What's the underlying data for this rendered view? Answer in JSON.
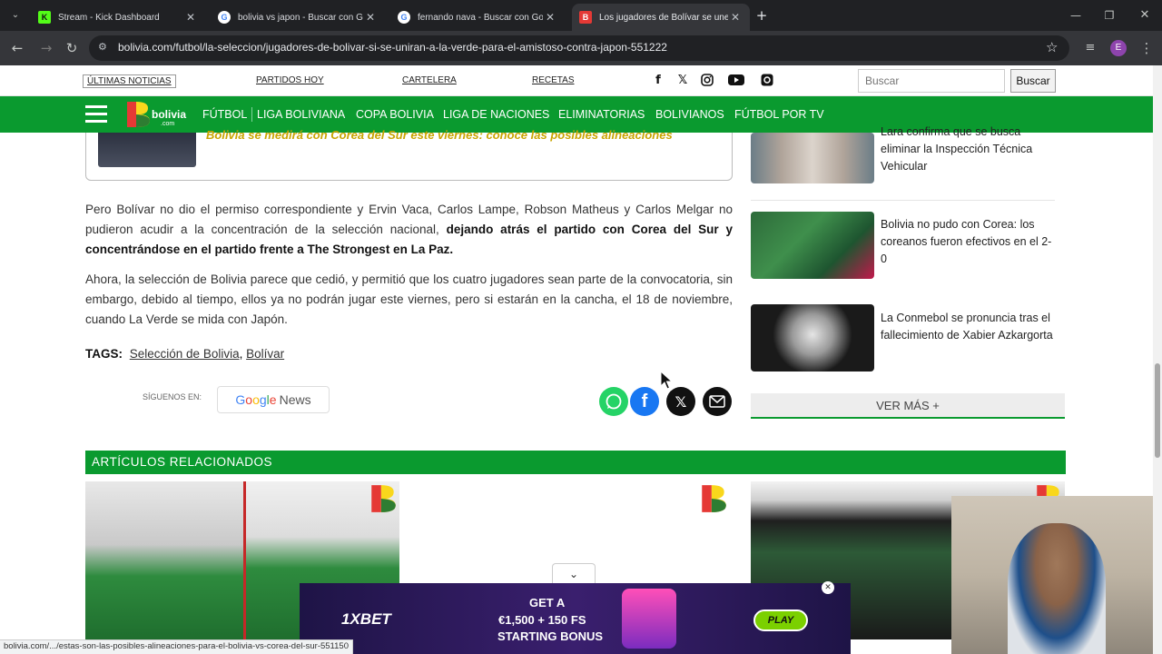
{
  "browser": {
    "tabs": [
      {
        "title": "Stream - Kick Dashboard",
        "favicon": "K",
        "favicon_color": "#53fc18",
        "active": false
      },
      {
        "title": "bolivia vs japon - Buscar con Google",
        "favicon": "G",
        "favicon_color": "#ffffff",
        "active": false
      },
      {
        "title": "fernando nava - Buscar con Google",
        "favicon": "G",
        "favicon_color": "#ffffff",
        "active": false
      },
      {
        "title": "Los jugadores de Bolívar se unen",
        "favicon": "B",
        "favicon_color": "#e53935",
        "active": true
      }
    ],
    "url": "bolivia.com/futbol/la-seleccion/jugadores-de-bolivar-si-se-uniran-a-la-verde-para-el-amistoso-contra-japon-551222",
    "profile_initial": "E",
    "status_url": "bolivia.com/.../estas-son-las-posibles-alineaciones-para-el-bolivia-vs-corea-del-sur-551150"
  },
  "topbar": {
    "links": [
      "ÚLTIMAS NOTICIAS",
      "PARTIDOS HOY",
      "CARTELERA",
      "RECETAS"
    ],
    "social_icons": [
      "facebook-icon",
      "x-icon",
      "instagram-icon",
      "youtube-icon",
      "threads-icon"
    ],
    "search_placeholder": "Buscar",
    "search_button": "Buscar"
  },
  "nav": {
    "logo_text": "bolivia",
    "logo_sub": ".com",
    "items": [
      "FÚTBOL",
      "LIGA BOLIVIANA",
      "COPA BOLIVIA",
      "LIGA DE NACIONES",
      "ELIMINATORIAS",
      "BOLIVIANOS",
      "FÚTBOL POR TV"
    ]
  },
  "article": {
    "embedded_card_title": "Bolivia se medirá con Corea del Sur este viernes: conoce las posibles alineaciones",
    "para1_normal": "Pero Bolívar no dio el permiso correspondiente y Ervin Vaca, Carlos Lampe, Robson Matheus y Carlos Melgar no pudieron acudir a la concentración de la selección nacional, ",
    "para1_bold": "dejando atrás el partido con Corea del Sur y concentrándose en el partido frente a The Strongest en La Paz.",
    "para2": "Ahora, la selección de Bolivia parece que cedió, y permitió que los cuatro jugadores sean parte de la convocatoria, sin embargo, debido al tiempo, ellos ya no podrán jugar este viernes, pero si estarán en la cancha, el 18 de noviembre, cuando La Verde se mida con Japón.",
    "tags_label": "TAGS:",
    "tags": [
      "Selección de Bolivia",
      "Bolívar"
    ],
    "follow_label": "SÍGUENOS EN:",
    "google_news": "News",
    "share_icons": [
      "whatsapp-icon",
      "facebook-icon",
      "x-icon",
      "email-icon"
    ]
  },
  "sidebar": {
    "items": [
      {
        "title": "Lara confirma que se busca eliminar la Inspección Técnica Vehicular"
      },
      {
        "title": "Bolivia no pudo con Corea: los coreanos fueron efectivos en el 2-0"
      },
      {
        "title": "La Conmebol se pronuncia tras el fallecimiento de Xabier Azkargorta"
      }
    ],
    "more_button": "VER MÁS +"
  },
  "related": {
    "title": "ARTÍCULOS RELACIONADOS"
  },
  "ad": {
    "brand": "1XBET",
    "line1": "GET A",
    "line2": "€1,500 + 150 FS",
    "line3": "STARTING BONUS",
    "play": "PLAY"
  },
  "colors": {
    "brand_green": "#0a9a2f",
    "chrome_dark": "#202124",
    "ad_purple": "#2a1a55"
  }
}
